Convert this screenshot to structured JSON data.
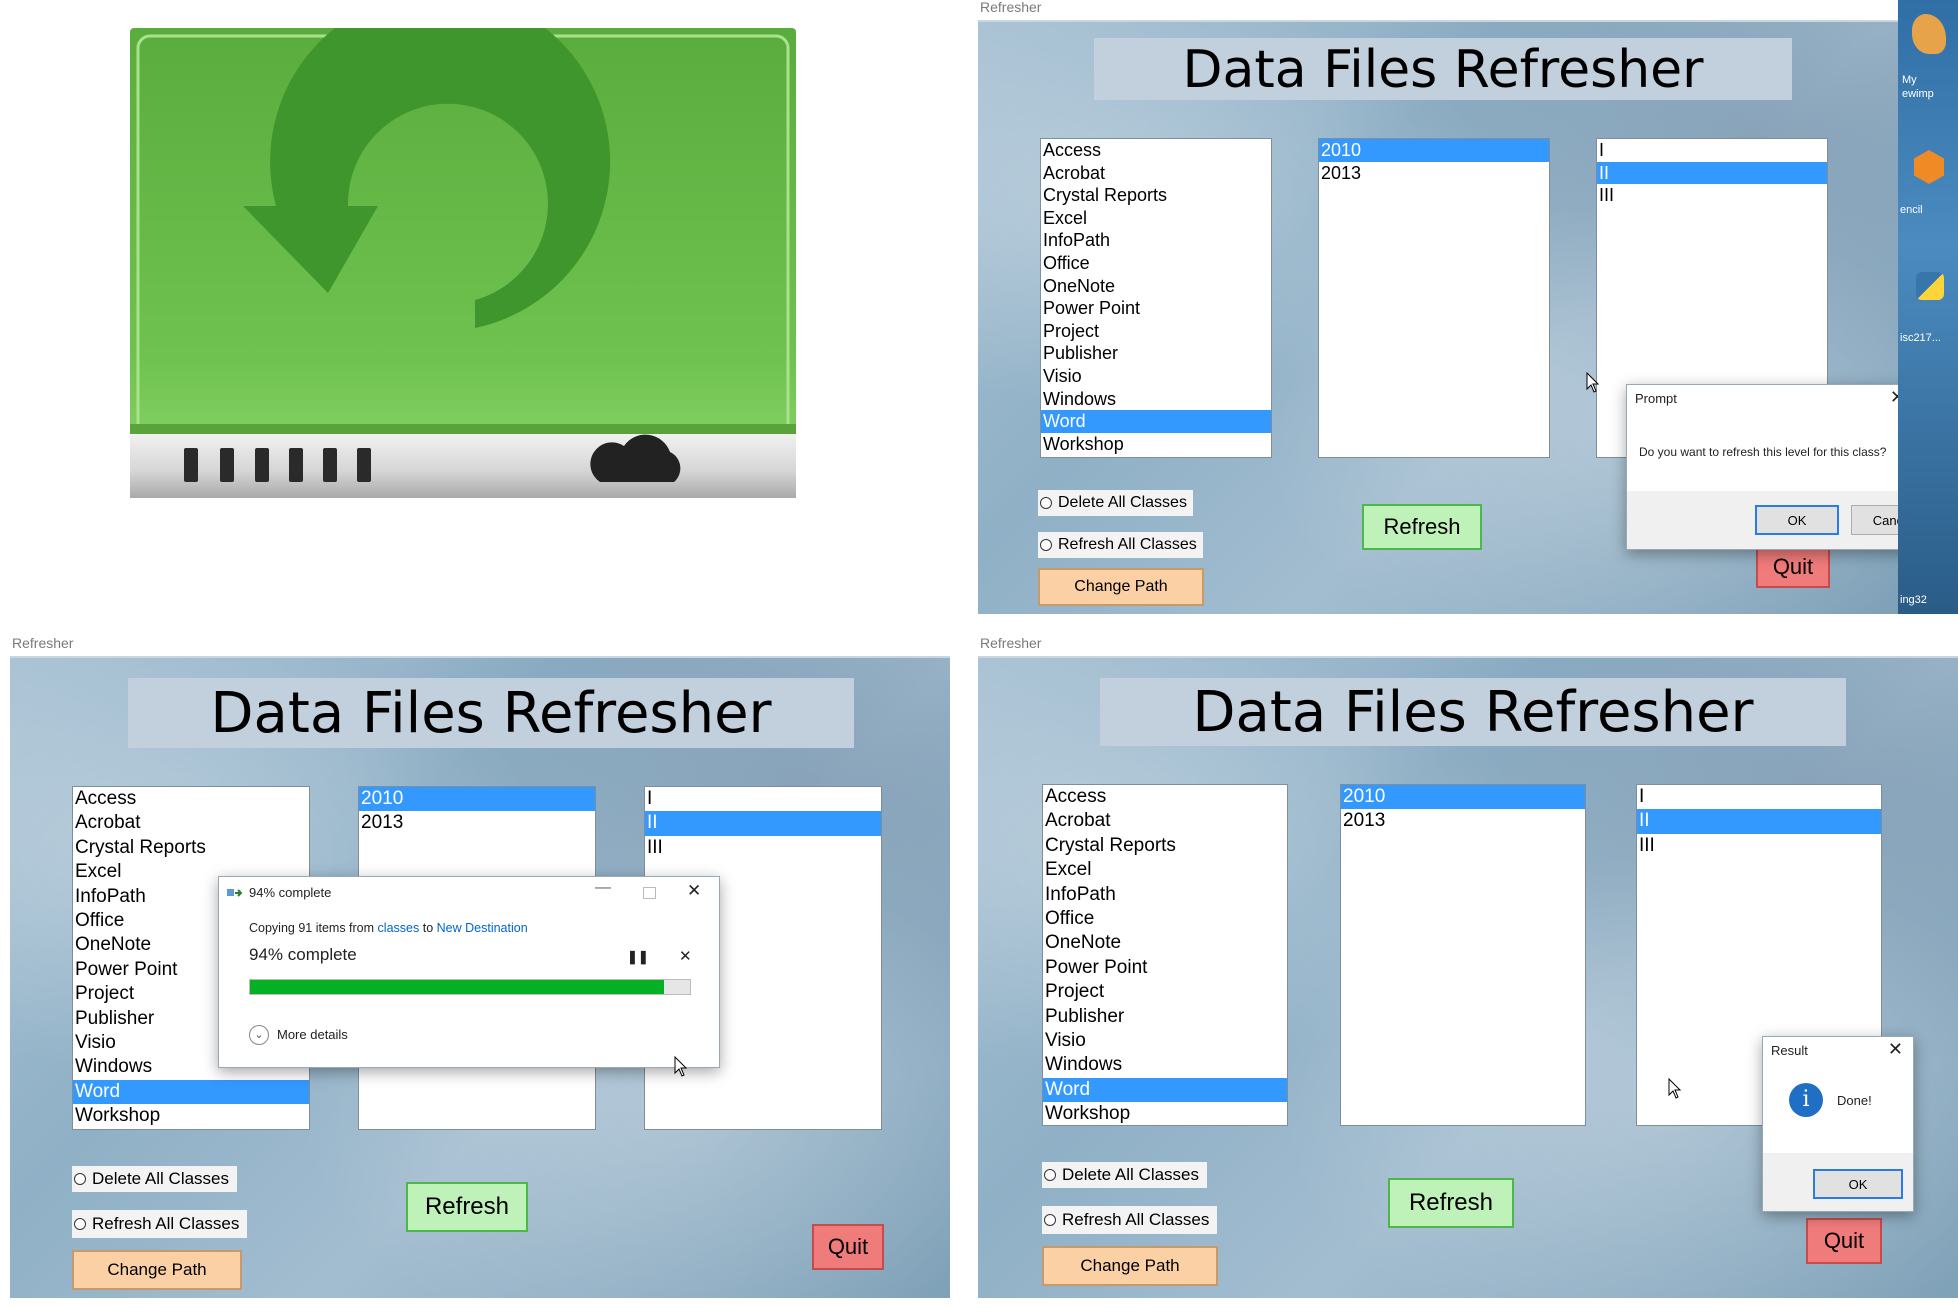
{
  "app_titlebar": "Refresher",
  "banner_title": "Data Files Refresher",
  "classes": [
    "Access",
    "Acrobat",
    "Crystal Reports",
    "Excel",
    "InfoPath",
    "Office",
    "OneNote",
    "Power Point",
    "Project",
    "Publisher",
    "Visio",
    "Windows",
    "Word",
    "Workshop"
  ],
  "classes_selected_index": 12,
  "years": [
    "2010",
    "2013"
  ],
  "years_selected_index": 0,
  "levels": [
    "I",
    "II",
    "III"
  ],
  "levels_selected_index": 1,
  "options": {
    "delete_all": "Delete All Classes",
    "refresh_all": "Refresh All Classes"
  },
  "buttons": {
    "refresh": "Refresh",
    "quit": "Quit",
    "change_path": "Change Path"
  },
  "prompt_dialog": {
    "title": "Prompt",
    "message": "Do you want to refresh this level for this class?",
    "ok": "OK",
    "cancel": "Cancel"
  },
  "copy_dialog": {
    "title": "94% complete",
    "copy_prefix": "Copying 91 items from",
    "source": "classes",
    "to_word": "to",
    "destination": "New Destination",
    "progress_text": "94% complete",
    "progress": 0.94,
    "more_details": "More details"
  },
  "result_dialog": {
    "title": "Result",
    "message": "Done!",
    "ok": "OK"
  },
  "desktop_icon_labels": {
    "a1": "My",
    "a2": "ewimp",
    "b": "encil",
    "c": "isc217...",
    "d": "ing32"
  },
  "colors": {
    "selection": "#3399ff",
    "refresh_button": "#bff2b8",
    "quit_button": "#f07b7b",
    "path_button": "#fbd0a4",
    "progress_fill": "#06b025",
    "banner": "#c2cfdc"
  }
}
